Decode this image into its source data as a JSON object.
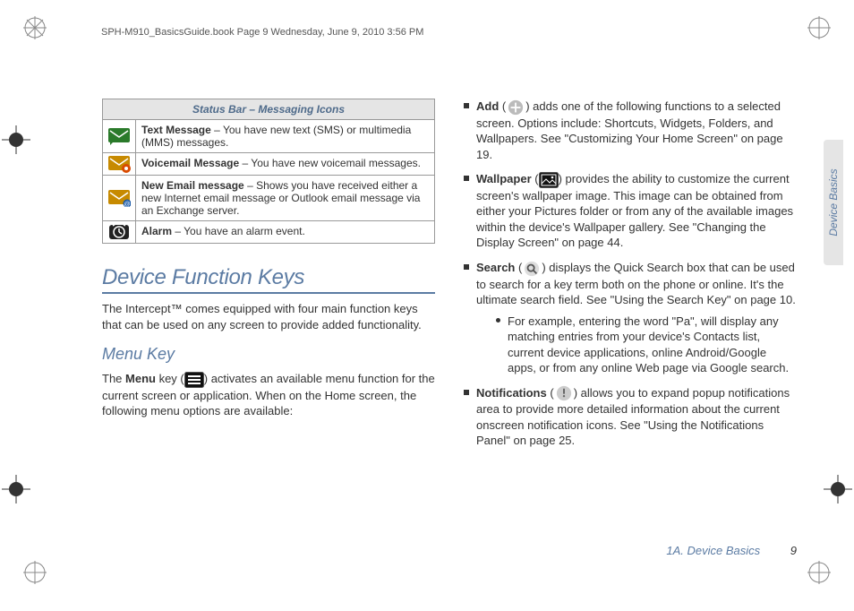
{
  "header": "SPH-M910_BasicsGuide.book  Page 9  Wednesday, June 9, 2010  3:56 PM",
  "side_tab": "Device Basics",
  "footer": {
    "chapter": "1A. Device Basics",
    "page": "9"
  },
  "table": {
    "title": "Status Bar – Messaging Icons",
    "rows": [
      {
        "label": "Text Message",
        "desc": " – You have new text (SMS) or multimedia (MMS) messages."
      },
      {
        "label": "Voicemail Message",
        "desc": " – You have new voicemail messages."
      },
      {
        "label": "New Email message",
        "desc": " – Shows you have received either a new Internet email message or Outlook email message via an Exchange server."
      },
      {
        "label": "Alarm",
        "desc": " – You have an alarm event."
      }
    ]
  },
  "section_title": "Device Function Keys",
  "intro": "The Intercept™ comes equipped with four main function keys that can be used on any screen to provide added functionality.",
  "subhead": "Menu Key",
  "menu_para_pre": "The ",
  "menu_key_label": "Menu",
  "menu_para_mid": " key (",
  "menu_para_post": ") activates an available menu function for the current screen or application. When on the Home screen, the following menu options are available:",
  "bullets": {
    "add": {
      "label": "Add",
      "text": ") adds one of the following functions to a selected screen. Options include: Shortcuts, Widgets, Folders, and Wallpapers. See \"Customizing Your Home Screen\" on page 19."
    },
    "wallpaper": {
      "label": "Wallpaper",
      "text": ") provides the ability to customize the current screen's wallpaper image. This image can be obtained from either your Pictures folder or from any of the available images within the device's Wallpaper gallery. See \"Changing the Display Screen\" on page 44."
    },
    "search": {
      "label": "Search",
      "text": ") displays the Quick Search box that can be used to search for a key term both on the phone or online. It's the ultimate search field. See \"Using the Search Key\" on page 10.",
      "sub": "For example, entering the word \"Pa\", will display any matching entries from your device's Contacts list, current device applications, online Android/Google apps, or from any online Web page via Google search."
    },
    "notifications": {
      "label": "Notifications",
      "text": ") allows you to expand popup notifications area to provide more detailed information about the current onscreen notification icons. See \"Using the Notifications Panel\" on page 25."
    }
  }
}
